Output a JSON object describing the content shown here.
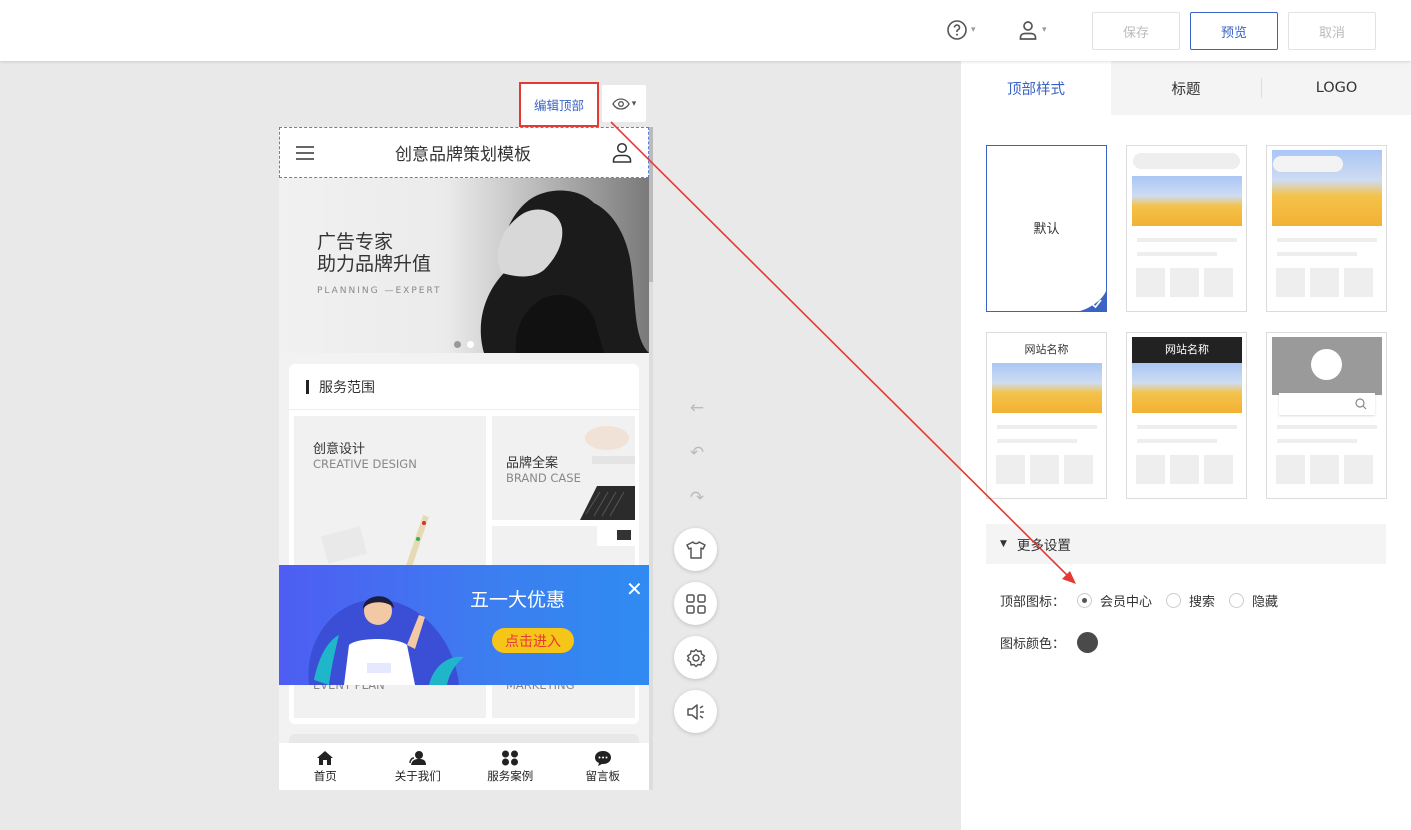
{
  "toolbar": {
    "help_icon": "question-circle-icon",
    "user_icon": "user-icon",
    "save_label": "保存",
    "preview_label": "预览",
    "cancel_label": "取消"
  },
  "canvas": {
    "edit_header_label": "编辑顶部",
    "eye_icon": "eye-icon"
  },
  "phone": {
    "header_title": "创意品牌策划模板",
    "banner": {
      "line1": "广告专家",
      "line2": "助力品牌升值",
      "line3": "PLANNING —EXPERT"
    },
    "section_title": "服务范围",
    "cards": [
      {
        "title": "创意设计",
        "subtitle": "CREATIVE DESIGN"
      },
      {
        "title": "品牌全案",
        "subtitle": "BRAND CASE"
      },
      {
        "title": "",
        "subtitle": "EVENT PLAN"
      },
      {
        "title": "",
        "subtitle": "MARKETING"
      }
    ],
    "popup": {
      "title": "五一大优惠",
      "button": "点击进入",
      "close": "✕"
    },
    "bottom_nav": [
      {
        "label": "首页",
        "icon": "home-icon"
      },
      {
        "label": "关于我们",
        "icon": "users-icon"
      },
      {
        "label": "服务案例",
        "icon": "grid-icon"
      },
      {
        "label": "留言板",
        "icon": "chat-icon"
      }
    ]
  },
  "tools": {
    "back": "←",
    "undo": "↶",
    "redo": "↷",
    "icons": [
      "shirt-icon",
      "apps-icon",
      "settings-icon",
      "megaphone-icon"
    ]
  },
  "panel": {
    "tabs": [
      "顶部样式",
      "标题",
      "LOGO"
    ],
    "active_tab": "顶部样式",
    "styles": [
      {
        "label": "默认",
        "selected": true
      },
      {
        "label": ""
      },
      {
        "label": ""
      },
      {
        "label": "网站名称"
      },
      {
        "label": "网站名称"
      },
      {
        "label": ""
      }
    ],
    "more_settings": "更多设置",
    "icon_setting_label": "顶部图标：",
    "icon_options": [
      "会员中心",
      "搜索",
      "隐藏"
    ],
    "icon_selected": "会员中心",
    "icon_color_label": "图标颜色：",
    "icon_color": "#4a4a4a",
    "accent_color": "#3a63c4"
  }
}
